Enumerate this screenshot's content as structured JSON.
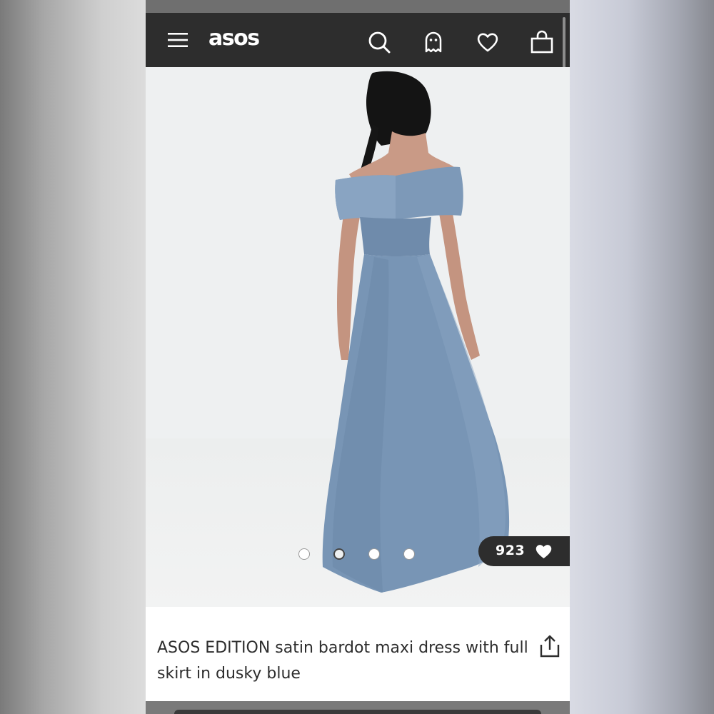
{
  "header": {
    "logo": "asos",
    "icons": [
      "menu-icon",
      "search-icon",
      "ghost-icon",
      "heart-icon",
      "bag-icon"
    ]
  },
  "product": {
    "image_subject": "blue off-shoulder satin maxi dress",
    "carousel": {
      "total": 4,
      "active_index": 1
    },
    "saves": "923",
    "title": "ASOS EDITION satin bardot maxi dress with full skirt in dusky blue"
  },
  "colors": {
    "header_bg": "#2d2d2d",
    "dress_blue": "#7c97b6",
    "image_bg": "#eef0f1",
    "title_text": "#2d2d2d"
  }
}
